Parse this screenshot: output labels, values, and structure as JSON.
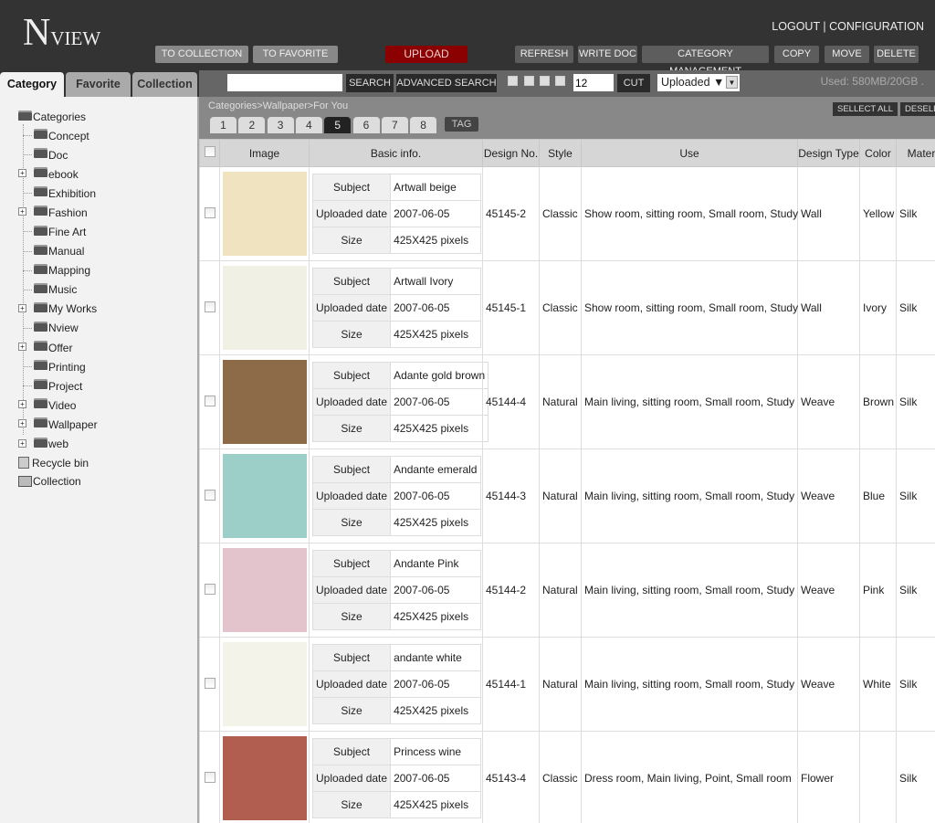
{
  "header": {
    "logo_big": "N",
    "logo_small": "VIEW",
    "logout": "LOGOUT",
    "sep": " | ",
    "configuration": "CONFIGURATION",
    "buttons": {
      "to_collection": "TO COLLECTION",
      "to_favorite": "TO FAVORITE",
      "upload": "UPLOAD",
      "refresh": "REFRESH",
      "write_doc": "WRITE DOC",
      "category_management": "CATEGORY MANAGEMENT",
      "copy": "COPY",
      "move": "MOVE",
      "delete": "DELETE"
    }
  },
  "side_tabs": [
    "Category",
    "Favorite",
    "Collection"
  ],
  "toolbar": {
    "search_value": "",
    "search": "SEARCH",
    "advanced_search": "ADVANCED SEARCH",
    "per_page": "12",
    "cut": "CUT",
    "sort": "Uploaded ▼",
    "used": "Used: 580MB/20GB ."
  },
  "breadcrumb": "Categories>Wallpaper>For You",
  "pages": [
    "1",
    "2",
    "3",
    "4",
    "5",
    "6",
    "7",
    "8"
  ],
  "active_page": "5",
  "tag": "TAG",
  "select_all": "SELLECT ALL",
  "deselect_all": "DESELLECT ALL",
  "tree": {
    "root": "Categories",
    "items": [
      {
        "label": "Concept",
        "expandable": false
      },
      {
        "label": "Doc",
        "expandable": false
      },
      {
        "label": "ebook",
        "expandable": true
      },
      {
        "label": "Exhibition",
        "expandable": false
      },
      {
        "label": "Fashion",
        "expandable": true
      },
      {
        "label": "Fine Art",
        "expandable": false
      },
      {
        "label": "Manual",
        "expandable": false
      },
      {
        "label": "Mapping",
        "expandable": false
      },
      {
        "label": "Music",
        "expandable": false
      },
      {
        "label": "My Works",
        "expandable": true
      },
      {
        "label": "Nview",
        "expandable": false
      },
      {
        "label": "Offer",
        "expandable": true
      },
      {
        "label": "Printing",
        "expandable": false
      },
      {
        "label": "Project",
        "expandable": false
      },
      {
        "label": "Video",
        "expandable": true
      },
      {
        "label": "Wallpaper",
        "expandable": true
      },
      {
        "label": "web",
        "expandable": true
      }
    ],
    "recycle": "Recycle bin",
    "collection": "Collection"
  },
  "table": {
    "columns": [
      "Image",
      "Basic info.",
      "Design No.",
      "Style",
      "Use",
      "Design Type",
      "Color",
      "Material"
    ],
    "info_labels": {
      "subject": "Subject",
      "date": "Uploaded date",
      "size": "Size"
    },
    "rows": [
      {
        "swatch": "#efe3c0",
        "subject": "Artwall beige",
        "date": "2007-06-05",
        "size": "425X425 pixels",
        "design_no": "45145-2",
        "style": "Classic",
        "use": "Show room, sitting room, Small room, Study",
        "type": "Wall",
        "color": "Yellow",
        "material": "Silk"
      },
      {
        "swatch": "#f0f0e4",
        "subject": "Artwall Ivory",
        "date": "2007-06-05",
        "size": "425X425 pixels",
        "design_no": "45145-1",
        "style": "Classic",
        "use": "Show room, sitting room, Small room, Study",
        "type": "Wall",
        "color": "Ivory",
        "material": "Silk"
      },
      {
        "swatch": "#8d6a48",
        "subject": "Adante gold brown",
        "date": "2007-06-05",
        "size": "425X425 pixels",
        "design_no": "45144-4",
        "style": "Natural",
        "use": "Main living, sitting room, Small room, Study",
        "type": "Weave",
        "color": "Brown",
        "material": "Silk"
      },
      {
        "swatch": "#9dcfc9",
        "subject": "Andante emerald",
        "date": "2007-06-05",
        "size": "425X425 pixels",
        "design_no": "45144-3",
        "style": "Natural",
        "use": "Main living, sitting room, Small room, Study",
        "type": "Weave",
        "color": "Blue",
        "material": "Silk"
      },
      {
        "swatch": "#e3c4cd",
        "subject": "Andante Pink",
        "date": "2007-06-05",
        "size": "425X425 pixels",
        "design_no": "45144-2",
        "style": "Natural",
        "use": "Main living, sitting room, Small room, Study",
        "type": "Weave",
        "color": "Pink",
        "material": "Silk"
      },
      {
        "swatch": "#f3f3ea",
        "subject": "andante white",
        "date": "2007-06-05",
        "size": "425X425 pixels",
        "design_no": "45144-1",
        "style": "Natural",
        "use": "Main living, sitting room, Small room, Study",
        "type": "Weave",
        "color": "White",
        "material": "Silk"
      },
      {
        "swatch": "#b15e51",
        "subject": "Princess wine",
        "date": "2007-06-05",
        "size": "425X425 pixels",
        "design_no": "45143-4",
        "style": "Classic",
        "use": "Dress room, Main living, Point, Small room",
        "type": "Flower",
        "color": "",
        "material": "Silk"
      }
    ]
  }
}
